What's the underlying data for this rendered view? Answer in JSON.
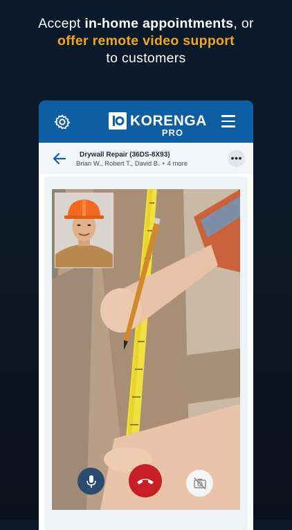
{
  "promo": {
    "line1_pre": "Accept ",
    "line1_bold": "in-home appointments",
    "line1_post": ", or",
    "line2_orange": "offer remote video support",
    "line3": "to customers"
  },
  "app": {
    "brand": "KORENGA",
    "brand_suffix": "PRO",
    "icons": {
      "settings": "gear-icon",
      "menu": "hamburger-menu-icon",
      "back": "arrow-left-icon",
      "more": "ellipsis-icon",
      "mic": "microphone-icon",
      "end_call": "phone-hangup-icon",
      "camera_off": "camera-off-icon"
    }
  },
  "call": {
    "title": "Drywall Repair (36DS-8X93)",
    "participants": "Brian W., Robert T., David B. + 4 more"
  },
  "colors": {
    "accent_orange": "#f4a51c",
    "appbar_blue": "#0e5ea3",
    "end_call_red": "#c62026",
    "mic_button_blue": "#2a4a70"
  }
}
